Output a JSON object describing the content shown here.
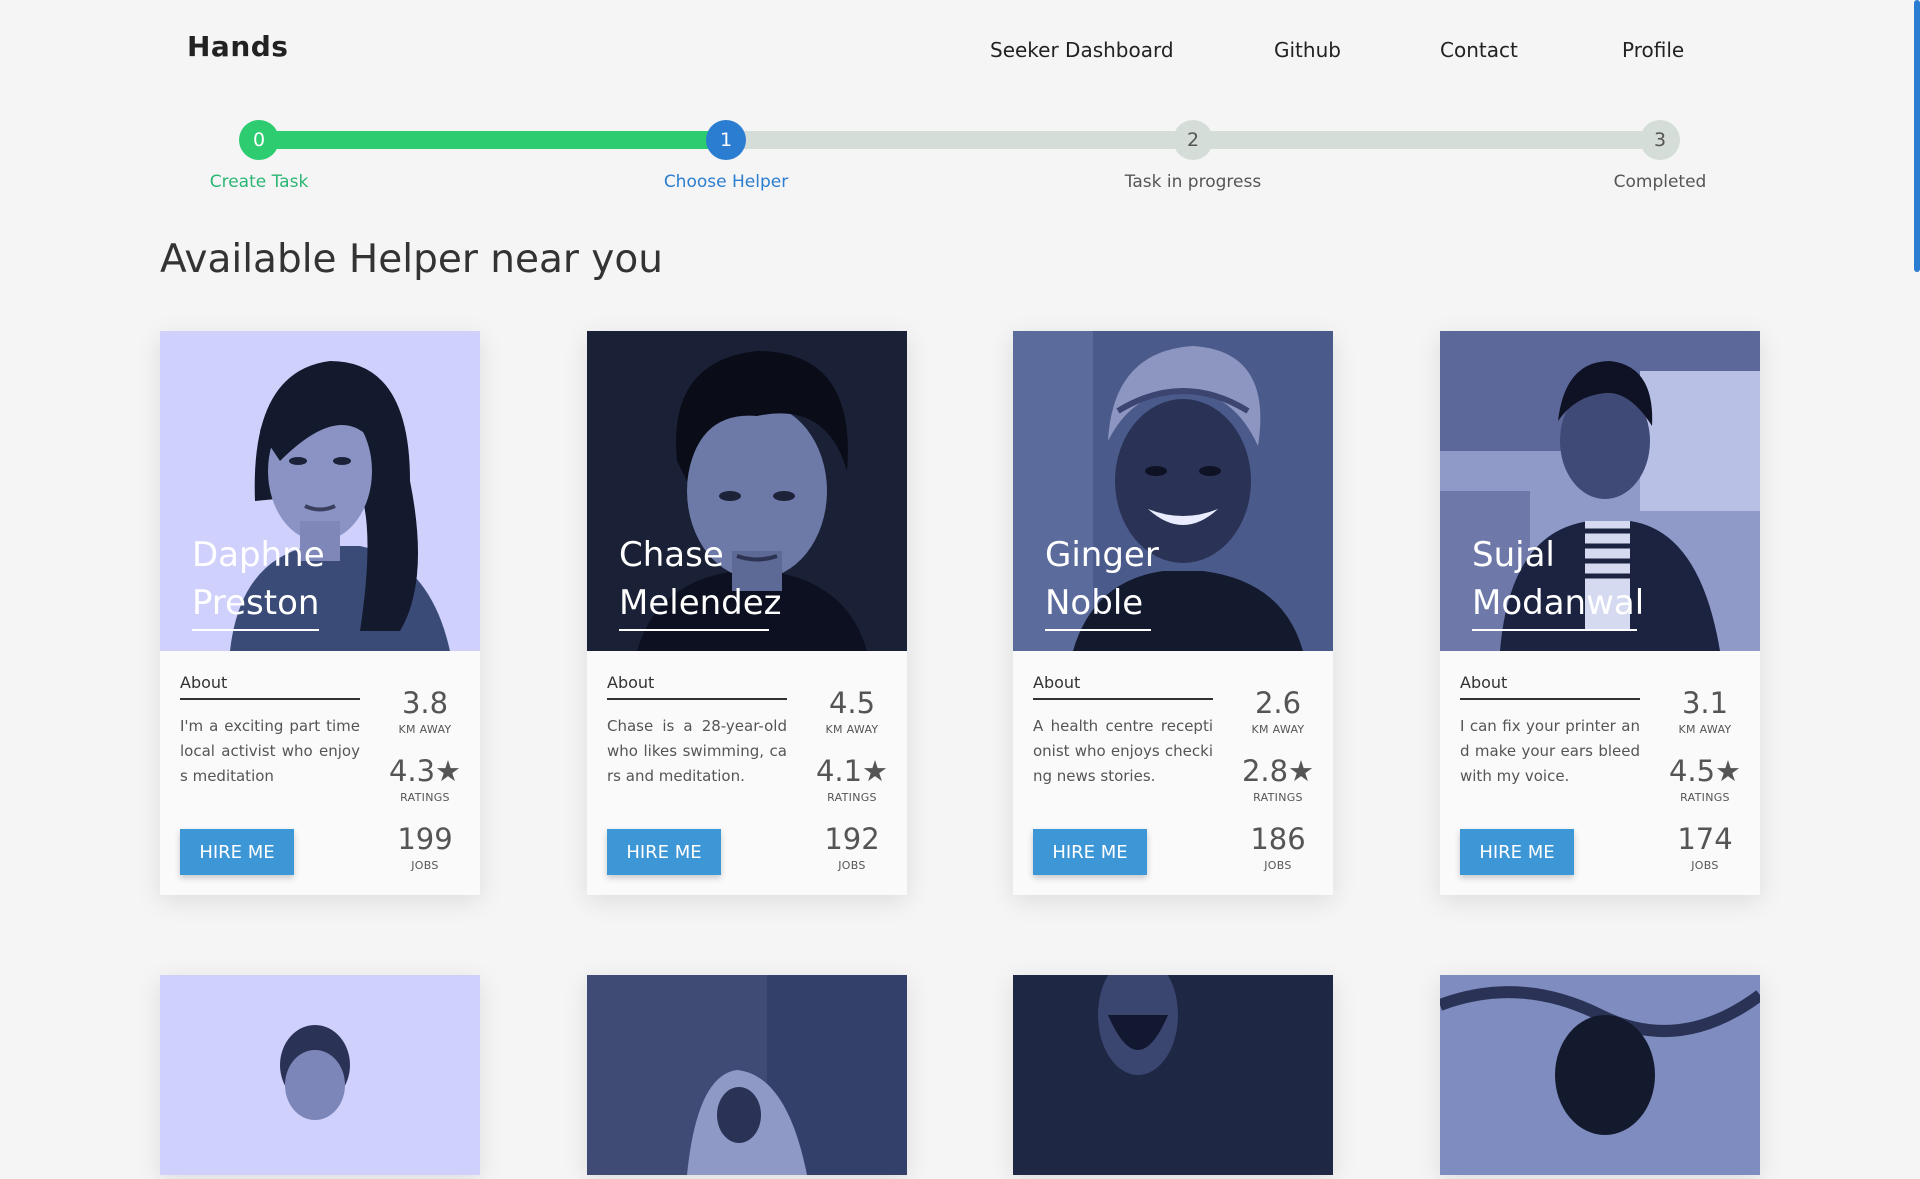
{
  "nav": {
    "brand": "Hands",
    "links": [
      "Seeker Dashboard",
      "Github",
      "Contact",
      "Profile"
    ]
  },
  "stepper": {
    "current_step": 1,
    "steps": [
      {
        "number": "0",
        "label": "Create Task"
      },
      {
        "number": "1",
        "label": "Choose Helper"
      },
      {
        "number": "2",
        "label": "Task in progress"
      },
      {
        "number": "3",
        "label": "Completed"
      }
    ],
    "colors": {
      "done": "#2ecc71",
      "active": "#2a7dd1",
      "pending": "#d5ddd8"
    }
  },
  "page_title": "Available Helper near you",
  "card_labels": {
    "about": "About",
    "km": "KM AWAY",
    "ratings": "RATINGS",
    "jobs": "JOBS",
    "hire": "HIRE ME"
  },
  "helpers": [
    {
      "first": "Daphne",
      "last": "Preston",
      "about": "I'm a exciting part time local activist who enjoys meditation",
      "km": "3.8",
      "rating": "4.3★",
      "jobs": "199"
    },
    {
      "first": "Chase",
      "last": "Melendez",
      "about": "Chase is a 28-year-old who likes swimming, cars and meditation.",
      "km": "4.5",
      "rating": "4.1★",
      "jobs": "192"
    },
    {
      "first": "Ginger",
      "last": "Noble",
      "about": "A health centre receptionist who enjoys checking news stories.",
      "km": "2.6",
      "rating": "2.8★",
      "jobs": "186"
    },
    {
      "first": "Sujal",
      "last": "Modanwal",
      "about": "I can fix your printer and make your ears bleed with my voice.",
      "km": "3.1",
      "rating": "4.5★",
      "jobs": "174"
    }
  ]
}
